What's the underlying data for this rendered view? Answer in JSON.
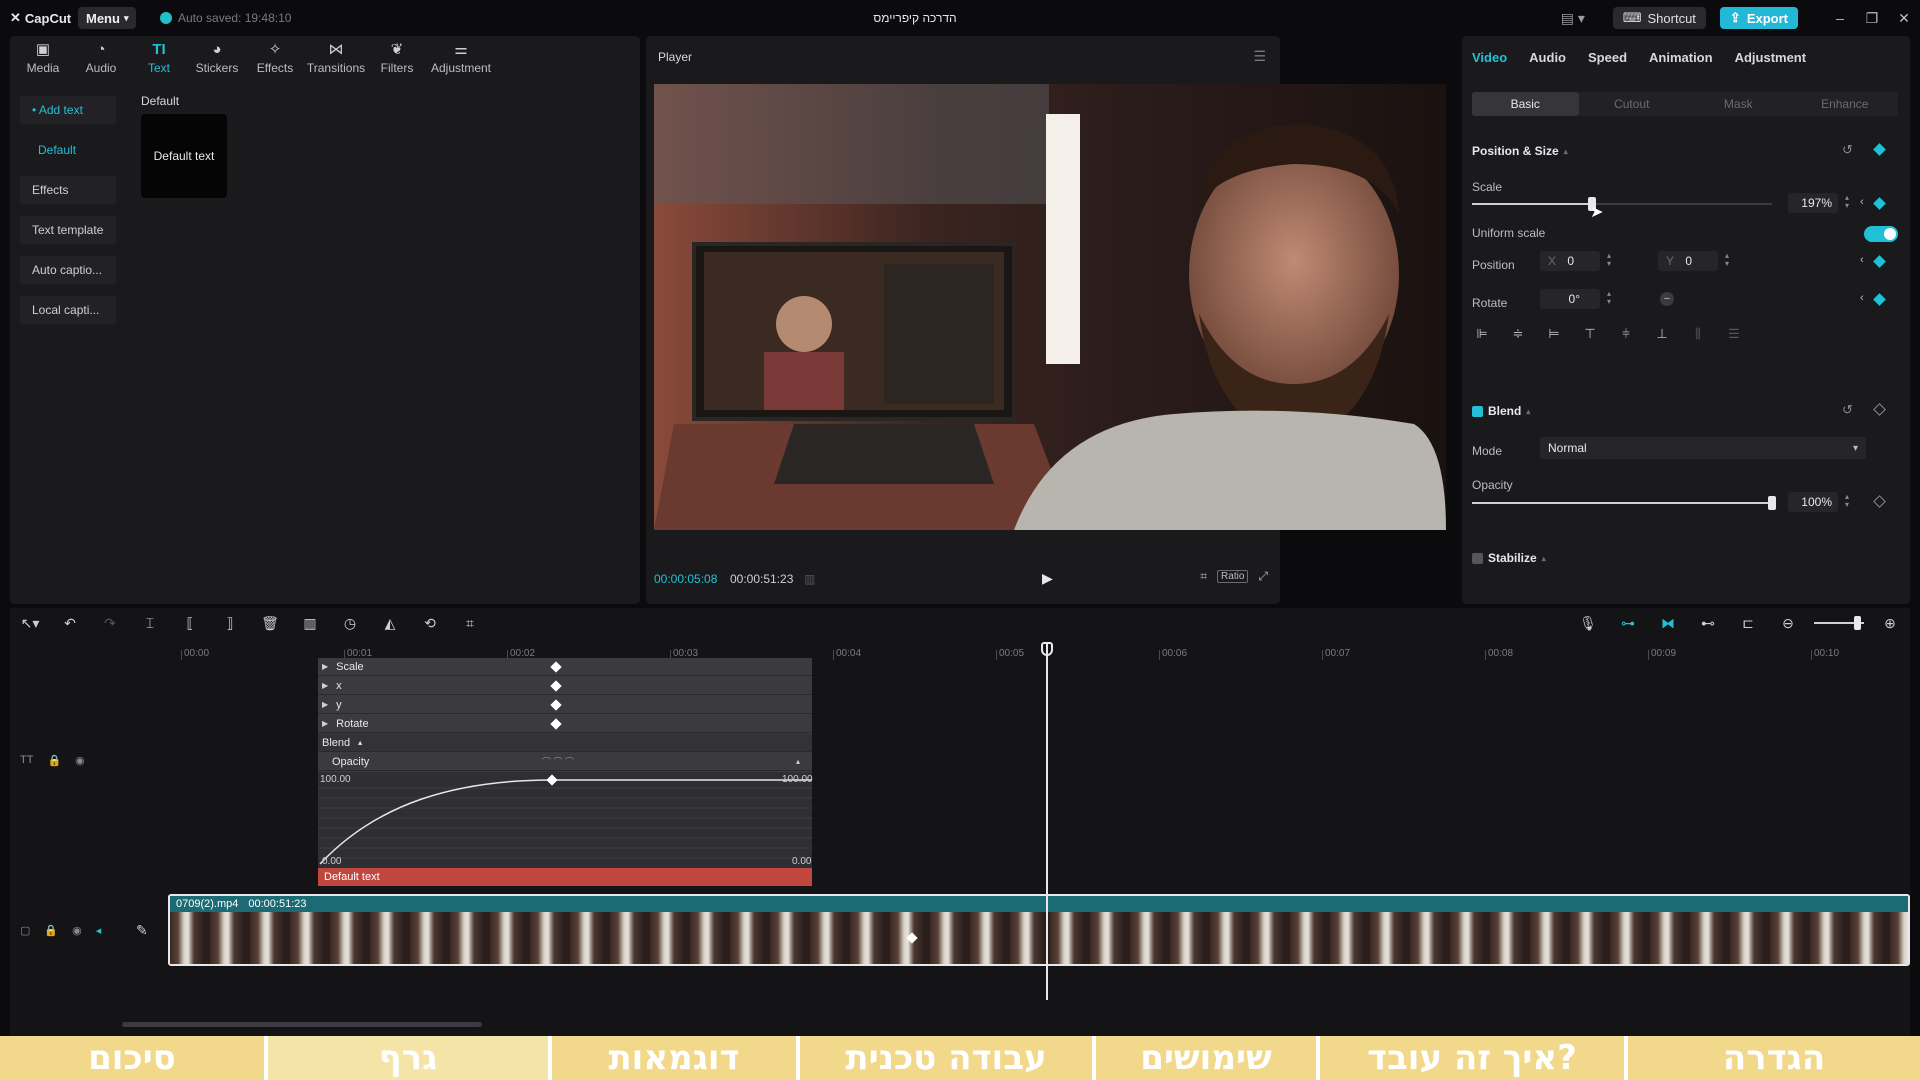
{
  "app": {
    "logo": "CapCut",
    "menu_label": "Menu",
    "autosave": "Auto saved: 19:48:10",
    "project_title": "הדרכה קיפריימס",
    "shortcut_label": "Shortcut",
    "export_label": "Export"
  },
  "left_panel": {
    "categories": [
      {
        "label": "Media",
        "icon": "media-icon"
      },
      {
        "label": "Audio",
        "icon": "audio-icon"
      },
      {
        "label": "Text",
        "icon": "text-icon"
      },
      {
        "label": "Stickers",
        "icon": "stickers-icon"
      },
      {
        "label": "Effects",
        "icon": "effects-icon"
      },
      {
        "label": "Transitions",
        "icon": "transitions-icon"
      },
      {
        "label": "Filters",
        "icon": "filters-icon"
      },
      {
        "label": "Adjustment",
        "icon": "adjustment-icon"
      }
    ],
    "active_category": "Text",
    "side_items": [
      "• Add text",
      "Default",
      "Effects",
      "Text template",
      "Auto captio...",
      "Local capti..."
    ],
    "section_header": "Default",
    "card_label": "Default text"
  },
  "player": {
    "title": "Player",
    "current_time": "00:00:05:08",
    "total_time": "00:00:51:23",
    "ratio_label": "Ratio"
  },
  "right_panel": {
    "tabs": [
      "Video",
      "Audio",
      "Speed",
      "Animation",
      "Adjustment"
    ],
    "active_tab": "Video",
    "subtabs": [
      "Basic",
      "Cutout",
      "Mask",
      "Enhance"
    ],
    "active_subtab": "Basic",
    "position_size": {
      "title": "Position & Size",
      "scale_label": "Scale",
      "scale_value": "197%",
      "scale_fraction": 0.4,
      "uniform_scale_label": "Uniform scale",
      "uniform_scale_on": true,
      "position_label": "Position",
      "x_prefix": "X",
      "x_value": "0",
      "y_prefix": "Y",
      "y_value": "0",
      "rotate_label": "Rotate",
      "rotate_value": "0°"
    },
    "blend": {
      "title": "Blend",
      "mode_label": "Mode",
      "mode_value": "Normal",
      "opacity_label": "Opacity",
      "opacity_value": "100%",
      "opacity_fraction": 1.0
    },
    "stabilize": {
      "title": "Stabilize"
    }
  },
  "timeline": {
    "ruler": [
      "00:00",
      "00:01",
      "00:02",
      "00:03",
      "00:04",
      "00:05",
      "00:06",
      "00:07",
      "00:08",
      "00:09",
      "00:10"
    ],
    "keyframe_rows": [
      "Scale",
      "x",
      "y",
      "Rotate"
    ],
    "blend_label": "Blend",
    "opacity_label": "Opacity",
    "graph_top_left": "100.00",
    "graph_top_right": "100.00",
    "graph_bottom_left": "0.00",
    "graph_bottom_right": "0.00",
    "text_clip_label": "Default text",
    "main_clip_name": "0709(2).mp4",
    "main_clip_duration": "00:00:51:23"
  },
  "chapters": [
    "סיכום",
    "גרף",
    "דוגמאות",
    "עבודה טכנית",
    "שימושים",
    "איך זה עובד?",
    "הגדרה"
  ],
  "colors": {
    "accent": "#22c0d6",
    "text_clip": "#c0463e",
    "main_clip_header": "#1c6a73",
    "chapter_bar": "#f2d88a"
  }
}
